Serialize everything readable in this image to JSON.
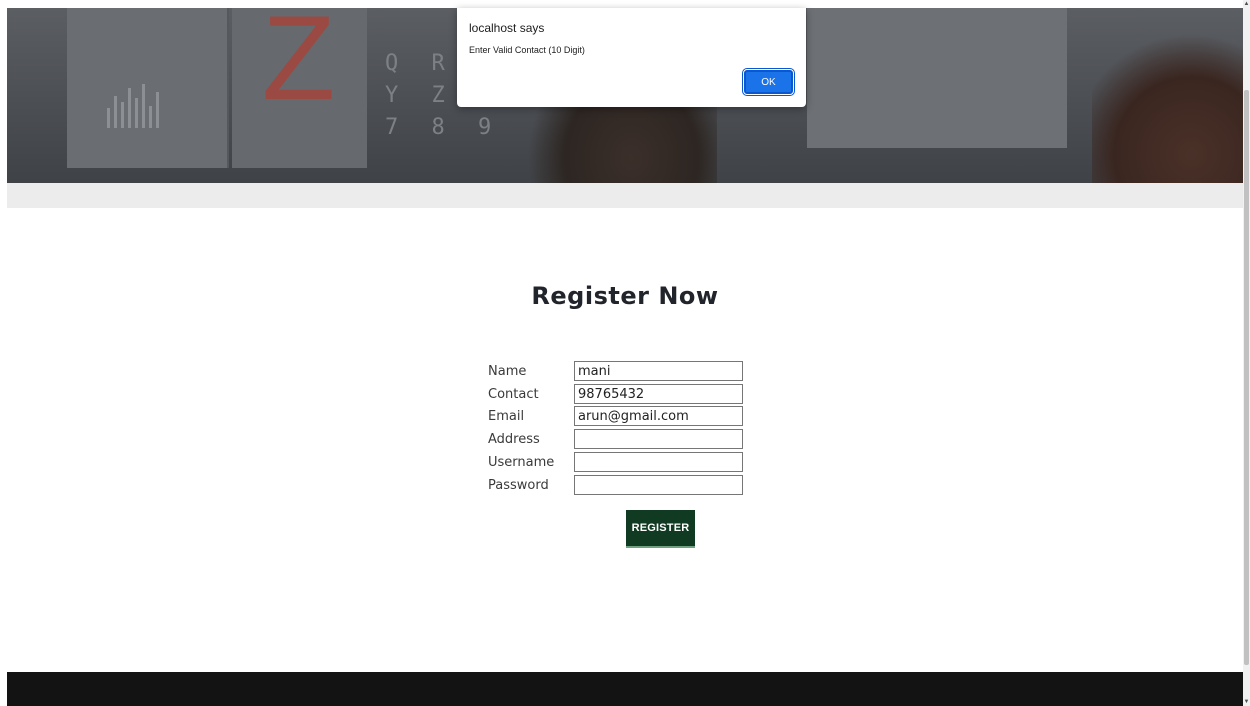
{
  "alert": {
    "title": "localhost says",
    "message": "Enter Valid Contact (10 Digit)",
    "ok_label": "OK"
  },
  "hero": {
    "big_letter": "Z",
    "chart_letters": "Q R S\nY Z\n7 8 9"
  },
  "form": {
    "title": "Register Now",
    "fields": [
      {
        "label": "Name",
        "value": "mani",
        "type": "text"
      },
      {
        "label": "Contact",
        "value": "98765432",
        "type": "text"
      },
      {
        "label": "Email",
        "value": "arun@gmail.com",
        "type": "text"
      },
      {
        "label": "Address",
        "value": "",
        "type": "text"
      },
      {
        "label": "Username",
        "value": "",
        "type": "text"
      },
      {
        "label": "Password",
        "value": "",
        "type": "password"
      }
    ],
    "submit_label": "REGISTER"
  },
  "colors": {
    "register_button": "#113a22",
    "footer": "#131313",
    "alert_ok": "#1a73e8"
  }
}
